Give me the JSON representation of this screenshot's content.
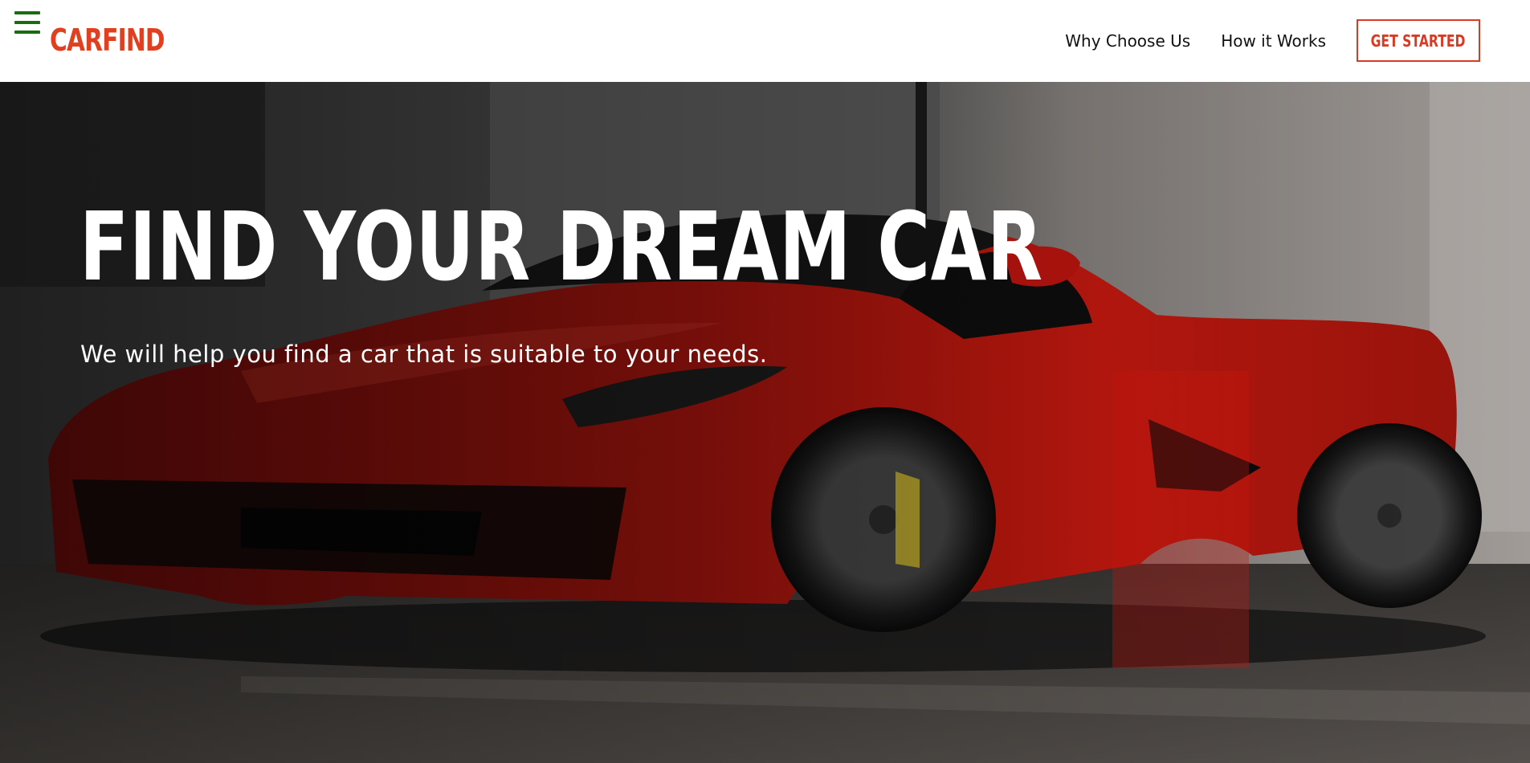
{
  "header": {
    "logo": "CARFIND",
    "nav": [
      {
        "label": "Why Choose Us"
      },
      {
        "label": "How it Works"
      }
    ],
    "cta_label": "GET STARTED"
  },
  "hero": {
    "title": "FIND YOUR DREAM CAR",
    "subtitle": "We will help you find a car that is suitable to your needs."
  },
  "colors": {
    "brand": "#e0401f",
    "menu_icon": "#1a6b12",
    "hero_text": "#ffffff",
    "car_red": "#c8140e"
  },
  "icons": {
    "menu": "hamburger-menu-icon"
  }
}
